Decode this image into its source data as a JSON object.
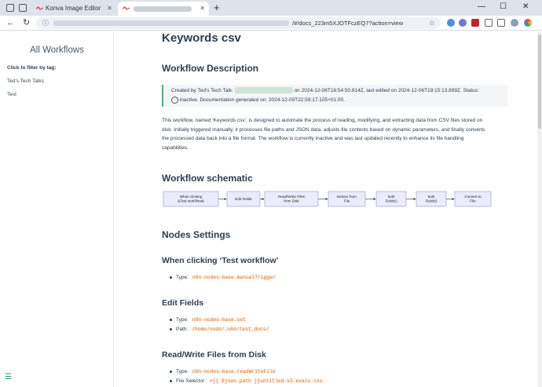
{
  "browser": {
    "tabs": [
      {
        "label": "Konva Image Editor",
        "active": false
      },
      {
        "label": "",
        "active": true
      }
    ],
    "url_visible_suffix": "/#/docs_223m5XJOTFczEQ7?action=view",
    "colors": {
      "tabbar": "#dde3ea",
      "accent_red": "#d7373f"
    }
  },
  "sidebar": {
    "title": "All Workflows",
    "filter_label": "Click to filter by tag:",
    "tags": [
      "Ted's Tech Talks",
      "Test"
    ]
  },
  "page": {
    "title": "Keywords csv",
    "workflow_description_heading": "Workflow Description",
    "callout": {
      "created_by": "Created by Ted's Tech Talk:",
      "created_on": "on 2024-12-06T18:54:50.814Z, last edited on 2024-12-06T19:15:13.899Z. Status:",
      "status": "inactive. Documentation generated on: 2024-12-09T22:59:17.105+01:00."
    },
    "description": "This workflow, named 'Keywords csv', is designed to automate the process of reading, modifying, and extracting data from CSV files stored on disk. Initially triggered manually, it processes file paths and JSON data, adjusts file contents based on dynamic parameters, and finally converts the processed data back into a file format. The workflow is currently inactive and was last updated recently to enhance its file handling capabilities.",
    "schematic_heading": "Workflow schematic",
    "schematic_nodes": [
      "When clicking &Test workflow&",
      "Edit Fields",
      "Read/Write Files from Disk",
      "Extract from File",
      "Edit Fields1",
      "Edit Fields2",
      "Convert to File"
    ],
    "nodes_settings_heading": "Nodes Settings",
    "nodes": [
      {
        "title": "When clicking ‘Test workflow’",
        "props": [
          {
            "label": "Type:",
            "value": "n8n-nodes-base.manualTrigger"
          }
        ]
      },
      {
        "title": "Edit Fields",
        "props": [
          {
            "label": "Type:",
            "value": "n8n-nodes-base.set"
          },
          {
            "label": "Path:",
            "value": "/home/node/.n8n/test_docs/"
          }
        ]
      },
      {
        "title": "Read/Write Files from Disk",
        "props": [
          {
            "label": "Type:",
            "value": "n8n-nodes-base.readWriteFile"
          },
          {
            "label": "File Selector:",
            "value": "={{ $json.path }}untitled-v2-evals.csv"
          }
        ]
      }
    ],
    "colors": {
      "accent_green": "#41b883",
      "code_orange": "#e96900",
      "text": "#2c3e50",
      "node_fill": "#ecebfb",
      "node_border": "#9b93d6"
    }
  }
}
